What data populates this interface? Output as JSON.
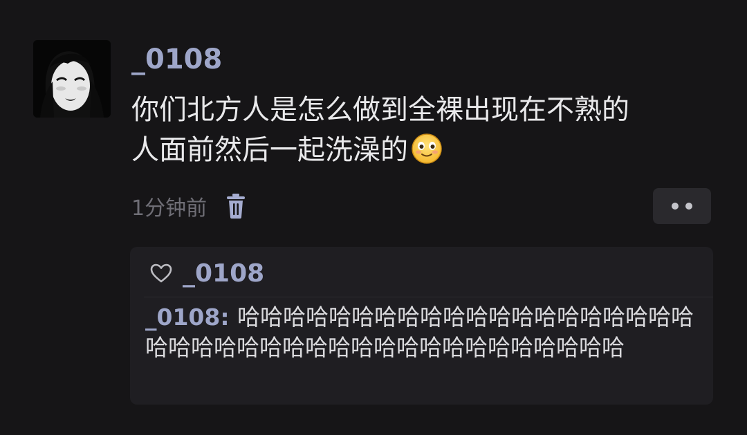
{
  "post": {
    "username": "_0108",
    "content_line1": "你们北方人是怎么做到全裸出现在不熟的",
    "content_line2": "人面前然后一起洗澡的",
    "emoji": "smiling-face-icon",
    "timestamp": "1分钟前",
    "delete_icon": "trash-icon",
    "more_icon": "more-dots-icon"
  },
  "reply_section": {
    "like_icon": "heart-outline-icon",
    "liker": "_0108",
    "reply": {
      "author": "_0108",
      "separator": ": ",
      "text": "哈哈哈哈哈哈哈哈哈哈哈哈哈哈哈哈哈哈哈哈哈哈哈哈哈哈哈哈哈哈哈哈哈哈哈哈哈哈哈哈哈"
    }
  },
  "colors": {
    "background": "#161517",
    "username": "#9ea6c9",
    "text": "#e9e9eb",
    "muted": "#6f6e76",
    "reply_background": "#1f1e22",
    "button_background": "#2a292d"
  }
}
